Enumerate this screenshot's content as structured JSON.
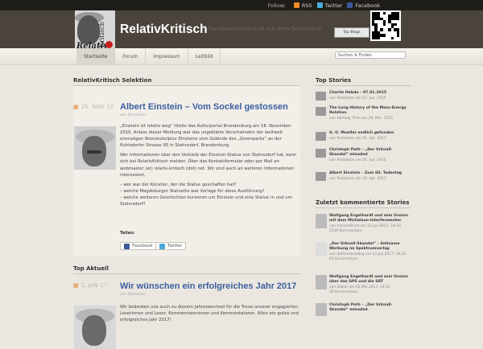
{
  "topbar": {
    "follow_label": "Follow:",
    "links": [
      {
        "label": "RSS",
        "icon": "rss-icon"
      },
      {
        "label": "Twitter",
        "icon": "twitter-icon"
      },
      {
        "label": "Facebook",
        "icon": "facebook-icon"
      }
    ]
  },
  "header": {
    "site_title": "RelativKritisch",
    "tagline": "Pseudowissenschaft auf dem Seziertisch",
    "logo_text_vertical": "Kritisch",
    "logo_text_bottom": "Relativ",
    "badge_text": "Top Blogs"
  },
  "nav": {
    "items": [
      "Startseite",
      "Forum",
      "Impressum",
      "Leitbild"
    ],
    "active_index": 0,
    "search_placeholder": "Suchen & Finden"
  },
  "colors": {
    "accent_link": "#3b5fa0",
    "date_icon": "#e08b3b",
    "header_bg": "#4a443c",
    "top_bar_bg": "#1f1d1a"
  },
  "main": {
    "section1_title": "RelativKritisch Selektion",
    "post1": {
      "date": "25. NOV",
      "date_num": "10",
      "title": "Albert Einstein – Vom Sockel gestossen",
      "meta": "von Redaktion",
      "paragraphs": [
        "„Einstein ist relativ weg“ titelte das Kulturportal Brandenburg am 18. November 2010. Anlass dieser Meldung war das ungeklärte Verschwinden der weltweit einmaligen Bronzeskulptur Einsteins vom Gelände des „Greenparks“ an der Ruhlsdorfer Strasse 95 in Stahnsdorf, Brandenburg.",
        "Wer Informationen über den Verbleib der Einstein-Statue von Stahnsdorf hat, kann sich bei RelativKritisch melden. Über das Kontaktformular oder per Mail an webmaster (at) relativ-kritisch (dot) net. Wir sind auch an weiteren Informationen interessiert,",
        "– wer war der Künstler, der die Statue geschaffen hat?",
        "– welche Magdeburger Statuette war Vorlage für diese Ausführung?",
        "– welche weiteren Geschichten kursieren um Einstein und eine Statue in und um Stahnsdorf?"
      ],
      "share_label": "Teilen:",
      "share_buttons": [
        "Facebook",
        "Twitter"
      ]
    },
    "section2_title": "Top Aktuell",
    "post2": {
      "date": "1. JAN",
      "date_num": "17",
      "title": "Wir wünschen ein erfolgreiches Jahr 2017",
      "meta": "von Redaktion",
      "paragraphs": [
        "Wir bedanken uns auch zu diesem Jahreswechsel für die Treue unserer engagierten Leserinnen und Leser, Kommentatorinnen und Kommentatoren. Allen ein gutes und erfolgreiches Jahr 2017!"
      ]
    }
  },
  "sidebar": {
    "top_stories_title": "Top Stories",
    "top_stories": [
      {
        "title": "Charlie Hebdo – 07.01.2015",
        "meta": "von Redaktion am 07. Jan. 2015"
      },
      {
        "title": "The Long History of the Mass-Energy Relation",
        "meta": "von Hartwig Thim am 29. Mrz. 2015"
      },
      {
        "title": "G. O. Mueller endlich gefunden",
        "meta": "von Redaktion am 01. Apr. 2015"
      },
      {
        "title": "Christoph Poth – „Der Urknall-Skandal“ mloaded",
        "meta": "von Redaktion am 05. Jun. 2015"
      },
      {
        "title": "Albert Einstein – Zum 60. Todestag",
        "meta": "von Redaktion am 18. Apr. 2015"
      }
    ],
    "recent_title": "Zuletzt kommentierte Stories",
    "recent": [
      {
        "title": "Wolfgang Engelhardt und sein Unsinn mit dem Michelson-Interferometer",
        "meta": "von michelePrart am 22.Jun.2017, 14:34",
        "count": "2539 Kommentare"
      },
      {
        "title": "„Der Urknall-Skandal“ – Seltsame Werbung im Spektrumverlag",
        "meta": "von daflisantrieding am 12.Jun.2017, 16:23",
        "count": "63 Kommentare"
      },
      {
        "title": "Wolfgang Engelhardt und sein Unsinn über das GPS und die SRT",
        "meta": "von Solkar am 05.Mai.2017, 14:22",
        "count": "38 Kommentare"
      },
      {
        "title": "Christoph Poth – „Der Urknall-Skandal“ mloaded",
        "meta": "",
        "count": ""
      }
    ]
  }
}
